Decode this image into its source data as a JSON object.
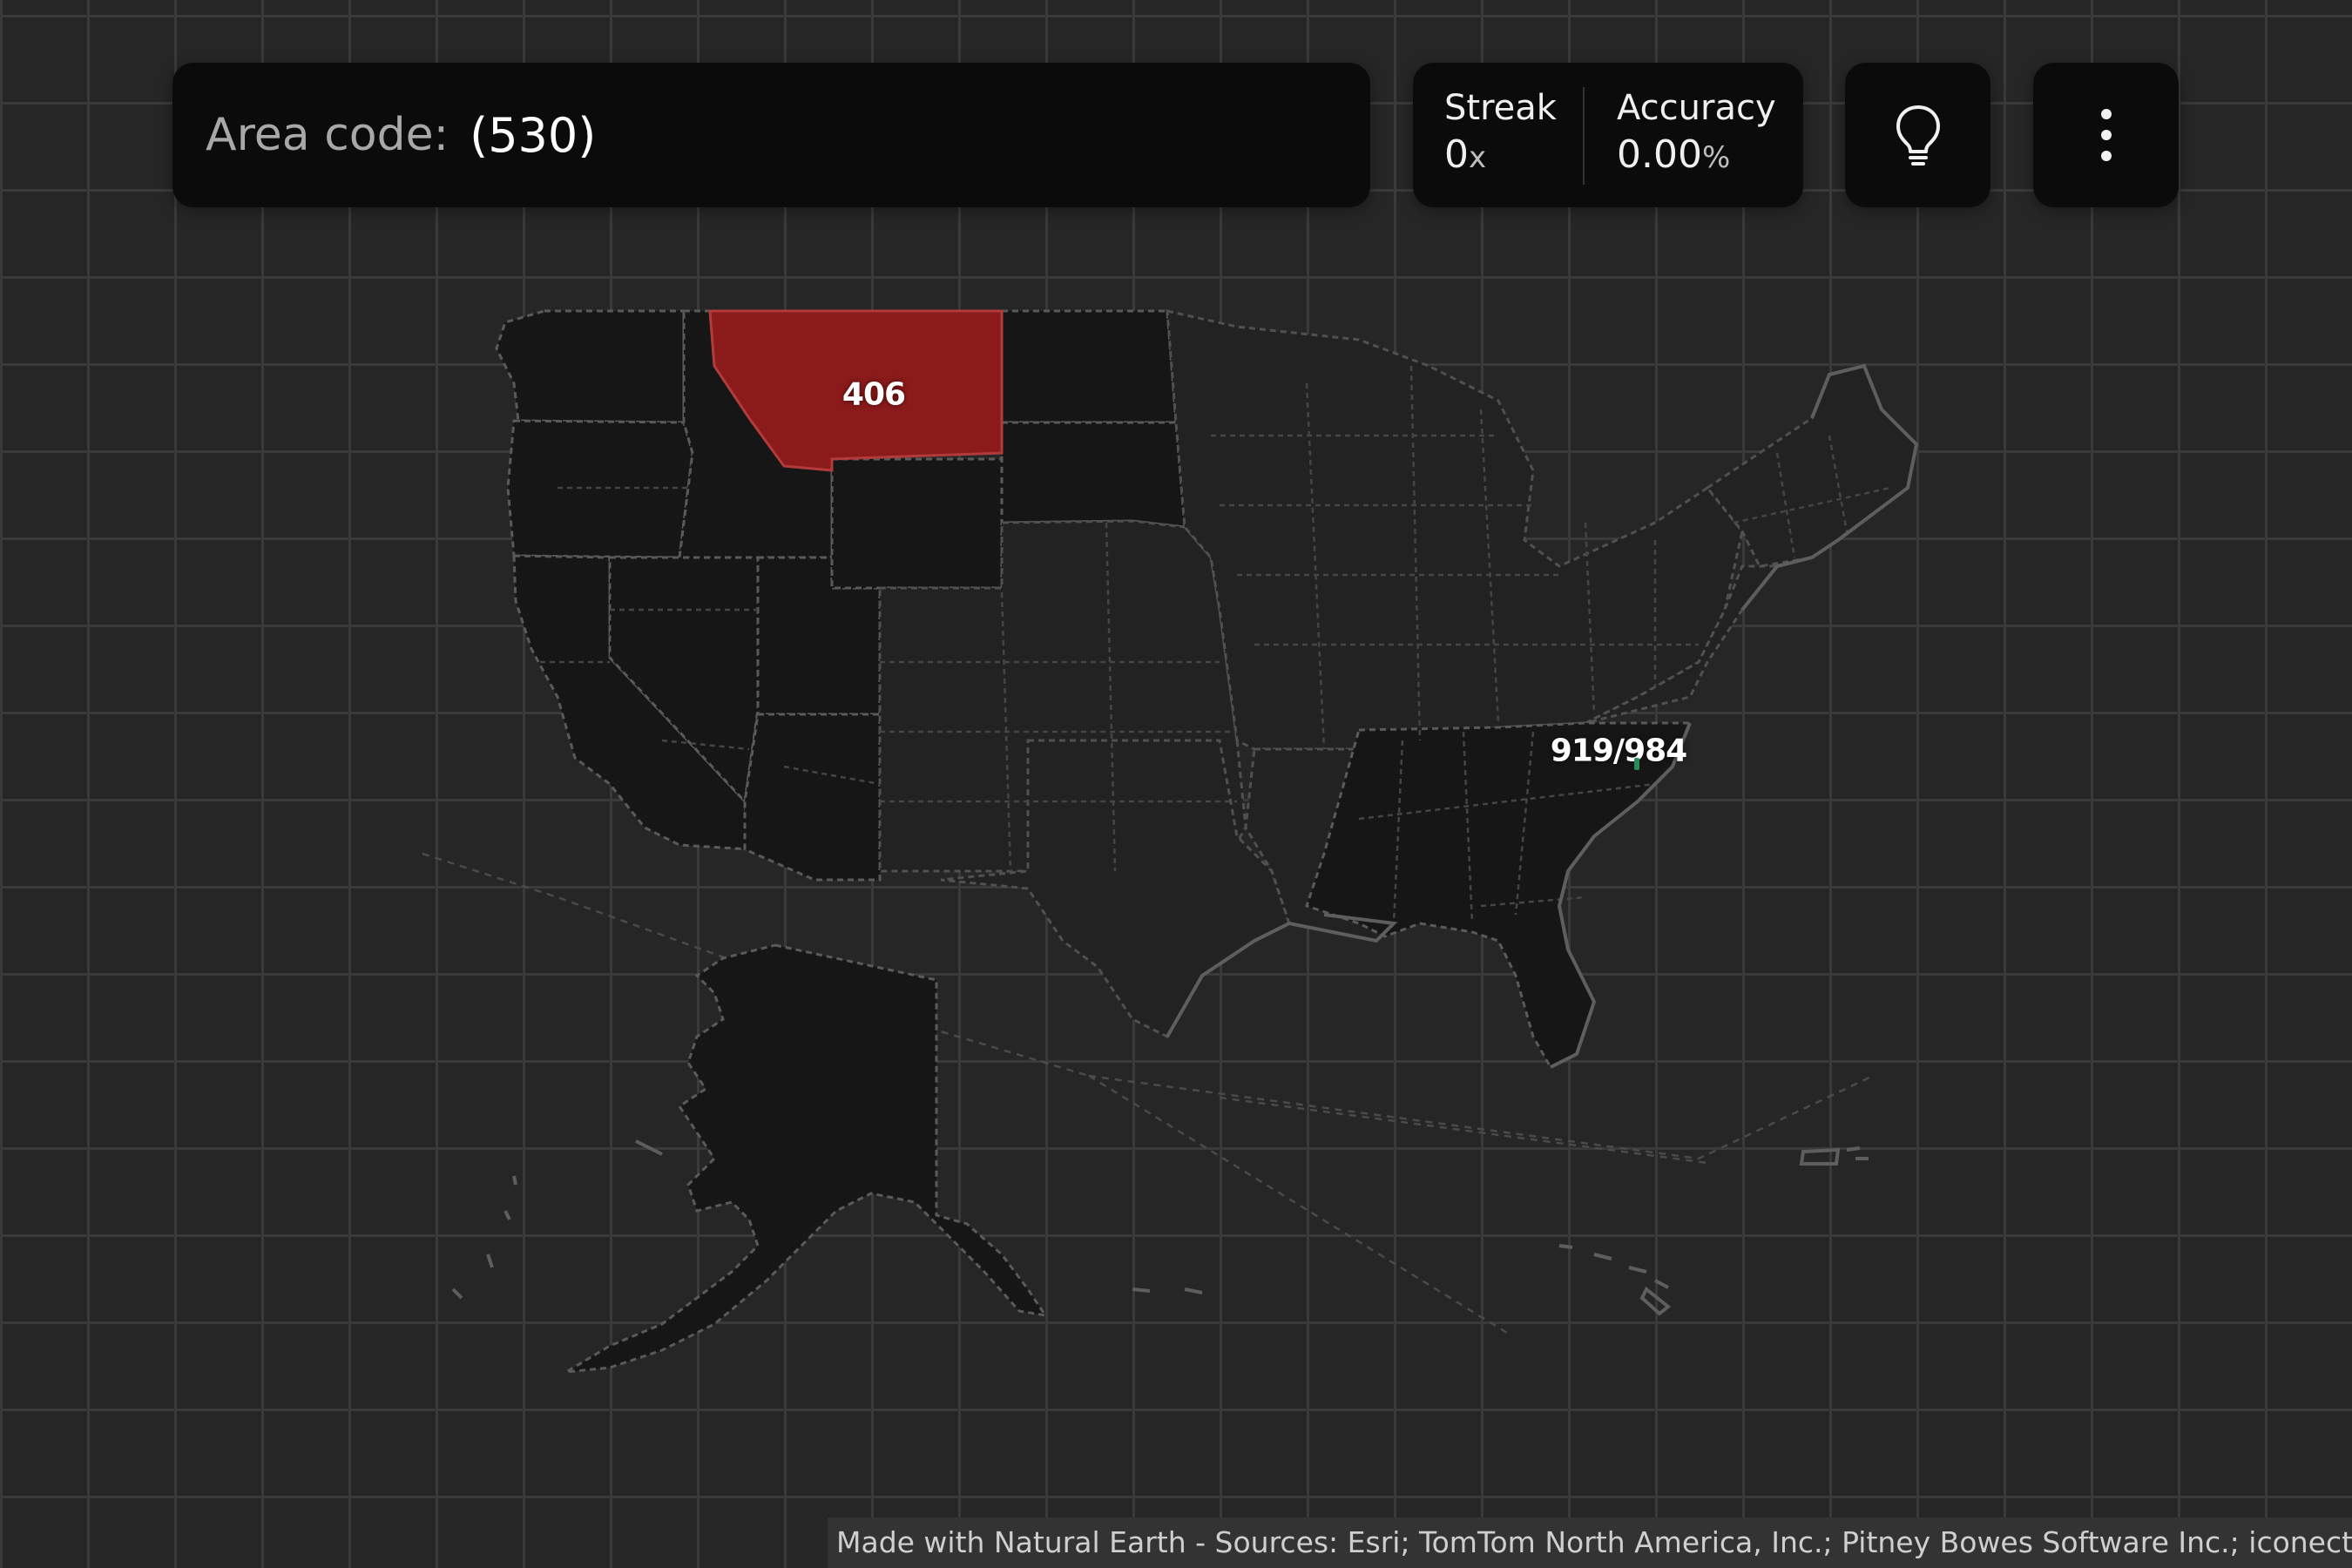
{
  "prompt": {
    "label": "Area code:",
    "value": "(530)"
  },
  "stats": {
    "streak": {
      "label": "Streak",
      "value": "0",
      "unit": "x"
    },
    "accuracy": {
      "label": "Accuracy",
      "value": "0.00",
      "unit": "%"
    }
  },
  "buttons": {
    "hint": "lightbulb-icon",
    "menu": "more-vertical-icon"
  },
  "map": {
    "labels": {
      "montana": "406",
      "north_carolina": "919/984"
    },
    "colors": {
      "wrong_guess": "#8b1a1a",
      "background": "#262626",
      "grid": "#3a3a3a"
    }
  },
  "attribution": "Made with Natural Earth - Sources: Esri; TomTom North America, Inc.; Pitney Bowes Software Inc.; iconectiv"
}
